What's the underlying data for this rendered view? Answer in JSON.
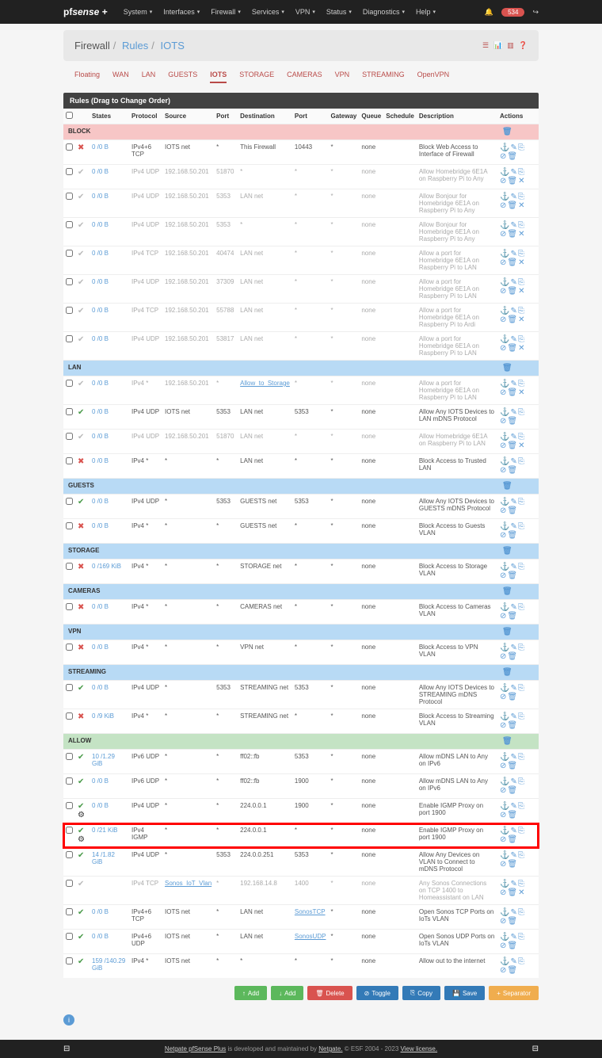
{
  "brand": {
    "prefix": "pf",
    "name": "sense",
    "suffix": "+"
  },
  "nav": [
    "System",
    "Interfaces",
    "Firewall",
    "Services",
    "VPN",
    "Status",
    "Diagnostics",
    "Help"
  ],
  "alert_count": "534",
  "breadcrumb": {
    "a": "Firewall",
    "b": "Rules",
    "c": "IOTS"
  },
  "tabs": [
    "Floating",
    "WAN",
    "LAN",
    "GUESTS",
    "IOTS",
    "STORAGE",
    "CAMERAS",
    "VPN",
    "STREAMING",
    "OpenVPN"
  ],
  "active_tab": "IOTS",
  "panel_title": "Rules (Drag to Change Order)",
  "columns": [
    "",
    "",
    "States",
    "Protocol",
    "Source",
    "Port",
    "Destination",
    "Port",
    "Gateway",
    "Queue",
    "Schedule",
    "Description",
    "Actions"
  ],
  "rules": [
    {
      "section": "BLOCK",
      "kind": "section"
    },
    {
      "state": "cross",
      "states": "0 /0 B",
      "proto": "IPv4+6 TCP",
      "src": "IOTS net",
      "port": "*",
      "dest": "This Firewall",
      "dport": "10443",
      "gw": "*",
      "queue": "none",
      "desc": "Block Web Access to Interface of Firewall"
    },
    {
      "state": "check",
      "faded": true,
      "states": "0 /0 B",
      "proto": "IPv4 UDP",
      "src": "192.168.50.201",
      "port": "51870",
      "dest": "*",
      "dport": "*",
      "gw": "*",
      "queue": "none",
      "desc": "Allow Homebridge 6E1A on Raspberry Pi to Any"
    },
    {
      "state": "check",
      "faded": true,
      "states": "0 /0 B",
      "proto": "IPv4 UDP",
      "src": "192.168.50.201",
      "port": "5353",
      "dest": "LAN net",
      "dport": "*",
      "gw": "*",
      "queue": "none",
      "desc": "Allow Bonjour for Homebridge 6E1A on Raspberry Pi to Any"
    },
    {
      "state": "check",
      "faded": true,
      "states": "0 /0 B",
      "proto": "IPv4 UDP",
      "src": "192.168.50.201",
      "port": "5353",
      "dest": "*",
      "dport": "*",
      "gw": "*",
      "queue": "none",
      "desc": "Allow Bonjour for Homebridge 6E1A on Raspberry Pi to Any"
    },
    {
      "state": "check",
      "faded": true,
      "states": "0 /0 B",
      "proto": "IPv4 TCP",
      "src": "192.168.50.201",
      "port": "40474",
      "dest": "LAN net",
      "dport": "*",
      "gw": "*",
      "queue": "none",
      "desc": "Allow a port for Homebridge 6E1A on Raspberry Pi to LAN"
    },
    {
      "state": "check",
      "faded": true,
      "states": "0 /0 B",
      "proto": "IPv4 UDP",
      "src": "192.168.50.201",
      "port": "37309",
      "dest": "LAN net",
      "dport": "*",
      "gw": "*",
      "queue": "none",
      "desc": "Allow a port for Homebridge 6E1A on Raspberry Pi to LAN"
    },
    {
      "state": "check",
      "faded": true,
      "states": "0 /0 B",
      "proto": "IPv4 TCP",
      "src": "192.168.50.201",
      "port": "55788",
      "dest": "LAN net",
      "dport": "*",
      "gw": "*",
      "queue": "none",
      "desc": "Allow a port for Homebridge 6E1A on Raspberry Pi to Ardi"
    },
    {
      "state": "check",
      "faded": true,
      "states": "0 /0 B",
      "proto": "IPv4 UDP",
      "src": "192.168.50.201",
      "port": "53817",
      "dest": "LAN net",
      "dport": "*",
      "gw": "*",
      "queue": "none",
      "desc": "Allow a port for Homebridge 6E1A on Raspberry Pi to LAN"
    },
    {
      "section": "LAN",
      "kind": "section",
      "cls": "lan"
    },
    {
      "state": "check",
      "faded": true,
      "states": "0 /0 B",
      "proto": "IPv4 *",
      "src": "192.168.50.201",
      "port": "*",
      "dest_alias": "Allow_to_Storage",
      "dport": "*",
      "gw": "*",
      "queue": "none",
      "desc": "Allow a port for Homebridge 6E1A on Raspberry Pi to LAN"
    },
    {
      "state": "check",
      "states": "0 /0 B",
      "proto": "IPv4 UDP",
      "src": "IOTS net",
      "port": "5353",
      "dest": "LAN net",
      "dport": "5353",
      "gw": "*",
      "queue": "none",
      "desc": "Allow Any IOTS Devices to LAN mDNS Protocol"
    },
    {
      "state": "check",
      "faded": true,
      "states": "0 /0 B",
      "proto": "IPv4 UDP",
      "src": "192.168.50.201",
      "port": "51870",
      "dest": "LAN net",
      "dport": "*",
      "gw": "*",
      "queue": "none",
      "desc": "Allow Homebridge 6E1A on Raspberry Pi to LAN"
    },
    {
      "state": "cross",
      "states": "0 /0 B",
      "proto": "IPv4 *",
      "src": "*",
      "port": "*",
      "dest": "LAN net",
      "dport": "*",
      "gw": "*",
      "queue": "none",
      "desc": "Block Access to Trusted LAN"
    },
    {
      "section": "GUESTS",
      "kind": "section",
      "cls": "guests"
    },
    {
      "state": "check",
      "states": "0 /0 B",
      "proto": "IPv4 UDP",
      "src": "*",
      "port": "5353",
      "dest": "GUESTS net",
      "dport": "5353",
      "gw": "*",
      "queue": "none",
      "desc": "Allow Any IOTS Devices to GUESTS mDNS Protocol"
    },
    {
      "state": "cross",
      "states": "0 /0 B",
      "proto": "IPv4 *",
      "src": "*",
      "port": "*",
      "dest": "GUESTS net",
      "dport": "*",
      "gw": "*",
      "queue": "none",
      "desc": "Block Access to Guests VLAN"
    },
    {
      "section": "STORAGE",
      "kind": "section",
      "cls": "storage"
    },
    {
      "state": "cross",
      "states": "0 /169 KiB",
      "proto": "IPv4 *",
      "src": "*",
      "port": "*",
      "dest": "STORAGE net",
      "dport": "*",
      "gw": "*",
      "queue": "none",
      "desc": "Block Access to Storage VLAN"
    },
    {
      "section": "CAMERAS",
      "kind": "section",
      "cls": "cameras"
    },
    {
      "state": "cross",
      "states": "0 /0 B",
      "proto": "IPv4 *",
      "src": "*",
      "port": "*",
      "dest": "CAMERAS net",
      "dport": "*",
      "gw": "*",
      "queue": "none",
      "desc": "Block Access to Cameras VLAN"
    },
    {
      "section": "VPN",
      "kind": "section",
      "cls": "vpn"
    },
    {
      "state": "cross",
      "states": "0 /0 B",
      "proto": "IPv4 *",
      "src": "*",
      "port": "*",
      "dest": "VPN net",
      "dport": "*",
      "gw": "*",
      "queue": "none",
      "desc": "Block Access to VPN VLAN"
    },
    {
      "section": "STREAMING",
      "kind": "section",
      "cls": "streaming"
    },
    {
      "state": "check",
      "states": "0 /0 B",
      "proto": "IPv4 UDP",
      "src": "*",
      "port": "5353",
      "dest": "STREAMING net",
      "dport": "5353",
      "gw": "*",
      "queue": "none",
      "desc": "Allow Any IOTS Devices to STREAMING mDNS Protocol"
    },
    {
      "state": "cross",
      "states": "0 /9 KiB",
      "proto": "IPv4 *",
      "src": "*",
      "port": "*",
      "dest": "STREAMING net",
      "dport": "*",
      "gw": "*",
      "queue": "none",
      "desc": "Block Access to Streaming VLAN"
    },
    {
      "section": "ALLOW",
      "kind": "section",
      "cls": "allow"
    },
    {
      "state": "check",
      "states": "10 /1.29 GiB",
      "proto": "IPv6 UDP",
      "src": "*",
      "port": "*",
      "dest": "ff02::fb",
      "dport": "5353",
      "gw": "*",
      "queue": "none",
      "desc": "Allow mDNS LAN to Any on IPv6"
    },
    {
      "state": "check",
      "states": "0 /0 B",
      "proto": "IPv6 UDP",
      "src": "*",
      "port": "*",
      "dest": "ff02::fb",
      "dport": "1900",
      "gw": "*",
      "queue": "none",
      "desc": "Allow mDNS LAN to Any on IPv6"
    },
    {
      "state": "check",
      "gear": true,
      "states": "0 /0 B",
      "proto": "IPv4 UDP",
      "src": "*",
      "port": "*",
      "dest": "224.0.0.1",
      "dport": "1900",
      "gw": "*",
      "queue": "none",
      "desc": "Enable IGMP Proxy on port 1900"
    },
    {
      "state": "check",
      "gear": true,
      "highlight": true,
      "states": "0 /21 KiB",
      "proto": "IPv4 IGMP",
      "src": "*",
      "port": "*",
      "dest": "224.0.0.1",
      "dport": "*",
      "gw": "*",
      "queue": "none",
      "desc": "Enable IGMP Proxy on port 1900"
    },
    {
      "state": "check",
      "states": "14 /1.82 GiB",
      "proto": "IPv4 UDP",
      "src": "*",
      "port": "5353",
      "dest": "224.0.0.251",
      "dport": "5353",
      "gw": "*",
      "queue": "none",
      "desc": "Allow Any Devices on VLAN to Connect to mDNS Protocol"
    },
    {
      "state": "check",
      "faded": true,
      "states": "",
      "proto": "IPv4 TCP",
      "src_alias": "Sonos_IoT_Vlan",
      "port": "*",
      "dest": "192.168.14.8",
      "dport": "1400",
      "gw": "*",
      "queue": "none",
      "desc": "Any Sonos Connections on TCP 1400 to Homeassistant on LAN"
    },
    {
      "state": "check",
      "states": "0 /0 B",
      "proto": "IPv4+6 TCP",
      "src": "IOTS net",
      "port": "*",
      "dest": "LAN net",
      "dport_alias": "SonosTCP",
      "gw": "*",
      "queue": "none",
      "desc": "Open Sonos TCP Ports on IoTs VLAN"
    },
    {
      "state": "check",
      "states": "0 /0 B",
      "proto": "IPv4+6 UDP",
      "src": "IOTS net",
      "port": "*",
      "dest": "LAN net",
      "dport_alias": "SonosUDP",
      "gw": "*",
      "queue": "none",
      "desc": "Open Sonos UDP Ports on IoTs VLAN"
    },
    {
      "state": "check",
      "states": "159 /140.29 GiB",
      "proto": "IPv4 *",
      "src": "IOTS net",
      "port": "*",
      "dest": "*",
      "dport": "*",
      "gw": "*",
      "queue": "none",
      "desc": "Allow out to the internet"
    }
  ],
  "buttons": {
    "add1": "Add",
    "add2": "Add",
    "del": "Delete",
    "toggle": "Toggle",
    "copy": "Copy",
    "save": "Save",
    "sep": "Separator"
  },
  "footer": {
    "product": "Netgate pfSense Plus",
    "mid": " is developed and maintained by ",
    "ng": "Netgate.",
    "copy": " © ESF 2004 - 2023 ",
    "view": "View license."
  }
}
